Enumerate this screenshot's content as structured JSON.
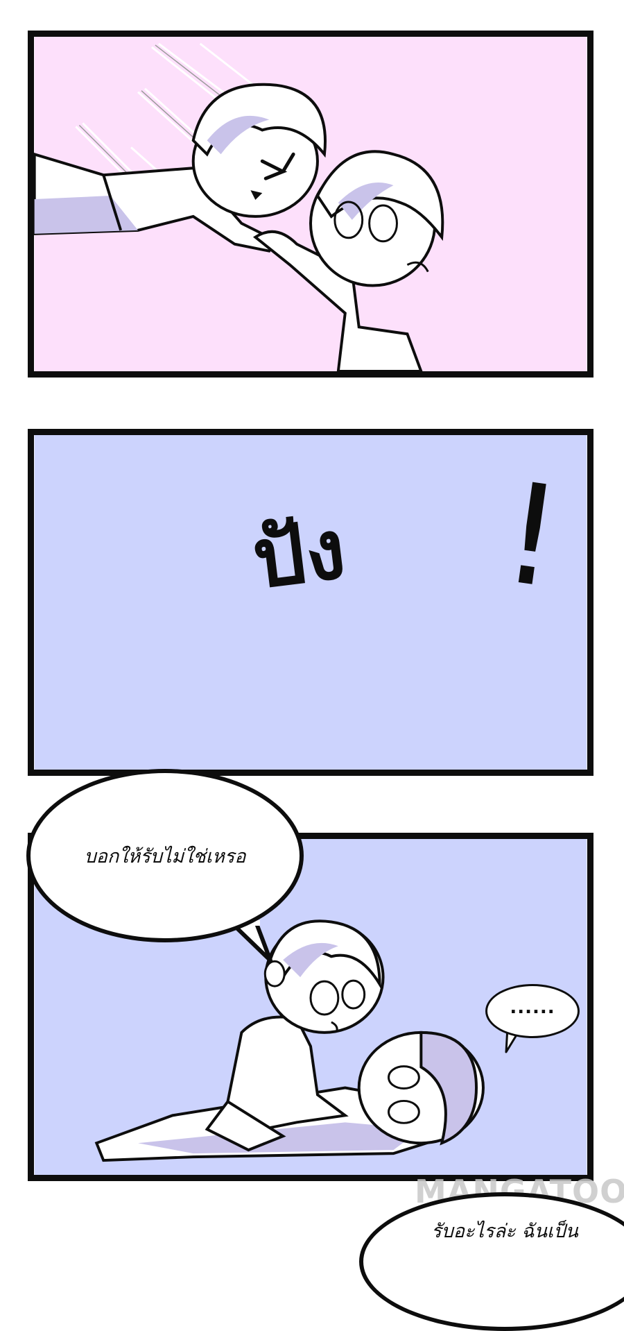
{
  "colors": {
    "panel1_bg": "#fde0fb",
    "panel2_bg": "#ccd3fd",
    "panel3_bg": "#ccd3fd",
    "ink": "#0d0d0d",
    "shade": "#c9c3ea",
    "skin": "#ffffff"
  },
  "panel2": {
    "sfx_word": "ปัง",
    "sfx_mark": "!"
  },
  "panel3": {
    "speech_main": "บอกให้รับไม่ใช่เหรอ",
    "speech_small": "......"
  },
  "next_panel": {
    "speech": "รับอะไรล่ะ ฉันเป็น"
  },
  "watermark": "MANGATOON"
}
